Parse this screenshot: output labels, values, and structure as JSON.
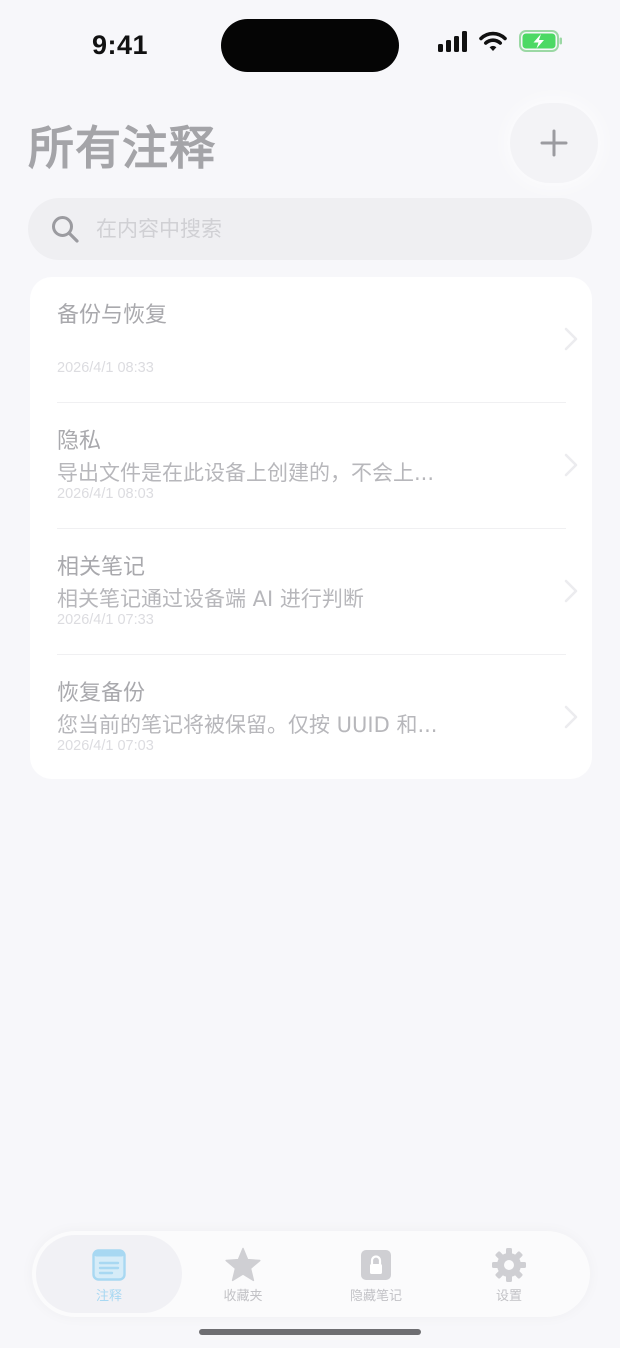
{
  "status_bar": {
    "time": "9:41"
  },
  "header": {
    "title": "所有注释",
    "add_symbol": "+"
  },
  "search": {
    "placeholder": "在内容中搜索"
  },
  "notes": [
    {
      "title": "备份与恢复",
      "preview": "",
      "date": "2026/4/1 08:33"
    },
    {
      "title": "隐私",
      "preview": "导出文件是在此设备上创建的，不会上...",
      "date": "2026/4/1 08:03"
    },
    {
      "title": "相关笔记",
      "preview": "相关笔记通过设备端 AI 进行判断",
      "date": "2026/4/1 07:33"
    },
    {
      "title": "恢复备份",
      "preview": "您当前的笔记将被保留。仅按 UUID 和...",
      "date": "2026/4/1 07:03"
    }
  ],
  "tab_bar": {
    "tabs": [
      {
        "label": "注释",
        "icon": "notes-icon",
        "active": true
      },
      {
        "label": "收藏夹",
        "icon": "star-icon",
        "active": false
      },
      {
        "label": "隐藏笔记",
        "icon": "lock-icon",
        "active": false
      },
      {
        "label": "设置",
        "icon": "gear-icon",
        "active": false
      }
    ]
  },
  "colors": {
    "background": "#f7f7fa",
    "accent": "#a8d8f2",
    "battery_fill": "#4cd964"
  }
}
